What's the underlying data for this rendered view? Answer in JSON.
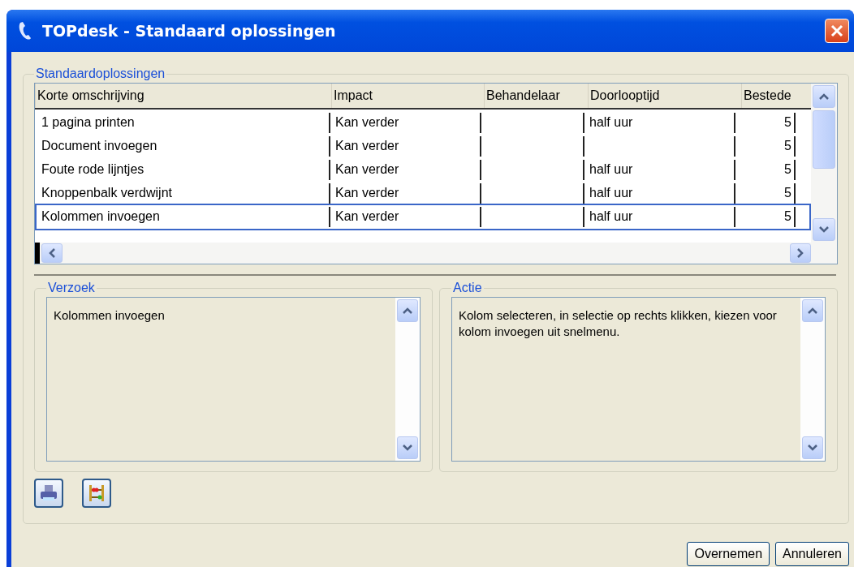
{
  "window": {
    "title": "TOPdesk - Standaard oplossingen"
  },
  "group": {
    "title": "Standaardoplossingen"
  },
  "table": {
    "columns": [
      "Korte omschrijving",
      "Impact",
      "Behandelaar",
      "Doorlooptijd",
      "Bestede"
    ],
    "rows": [
      {
        "cells": [
          "1 pagina printen",
          "Kan verder",
          "",
          "half uur",
          "5"
        ],
        "selected": false
      },
      {
        "cells": [
          "Document invoegen",
          "Kan verder",
          "",
          "",
          "5"
        ],
        "selected": false
      },
      {
        "cells": [
          "Foute rode lijntjes",
          "Kan verder",
          "",
          "half uur",
          "5"
        ],
        "selected": false
      },
      {
        "cells": [
          "Knoppenbalk verdwijnt",
          "Kan verder",
          "",
          "half uur",
          "5"
        ],
        "selected": false
      },
      {
        "cells": [
          "Kolommen invoegen",
          "Kan verder",
          "",
          "half uur",
          "5"
        ],
        "selected": true
      }
    ]
  },
  "panels": [
    {
      "title": "Verzoek",
      "text": "Kolommen invoegen"
    },
    {
      "title": "Actie",
      "text": "Kolom selecteren, in selectie op rechts klikken, kiezen voor kolom invoegen uit snelmenu."
    }
  ],
  "buttons": [
    "Overnemen",
    "Annuleren"
  ]
}
